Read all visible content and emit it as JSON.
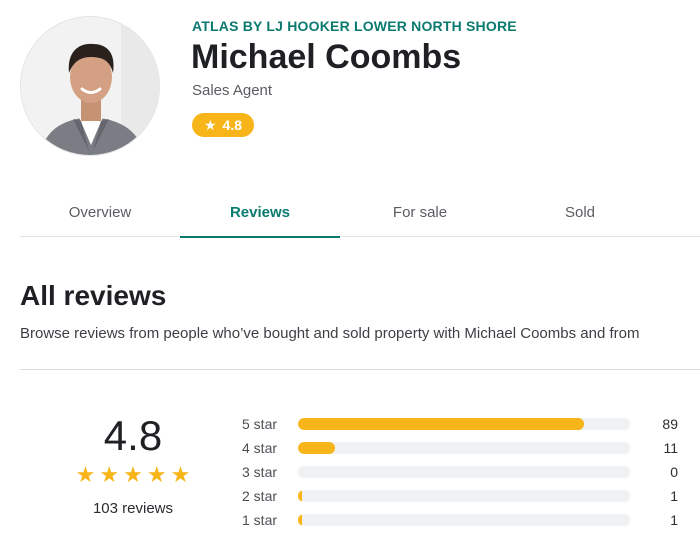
{
  "agent": {
    "agency": "ATLAS BY LJ HOOKER LOWER NORTH SHORE",
    "name": "Michael Coombs",
    "role": "Sales Agent",
    "rating": "4.8"
  },
  "tabs": [
    {
      "label": "Overview",
      "active": false
    },
    {
      "label": "Reviews",
      "active": true
    },
    {
      "label": "For sale",
      "active": false
    },
    {
      "label": "Sold",
      "active": false
    }
  ],
  "reviews": {
    "title": "All reviews",
    "description": "Browse reviews from people who’ve bought and sold property with Michael Coombs and from",
    "summary": {
      "score": "4.8",
      "stars": 5,
      "count_text": "103 reviews"
    },
    "breakdown": [
      {
        "label": "5 star",
        "count": "89",
        "fraction": 0.86
      },
      {
        "label": "4 star",
        "count": "11",
        "fraction": 0.11
      },
      {
        "label": "3 star",
        "count": "0",
        "fraction": 0
      },
      {
        "label": "2 star",
        "count": "1",
        "fraction": 0.011
      },
      {
        "label": "1 star",
        "count": "1",
        "fraction": 0.011
      }
    ]
  },
  "icons": {
    "star": "star-icon"
  },
  "colors": {
    "accent": "#0b7a6e",
    "rating": "#f7b51a",
    "track": "#f0f1f3"
  }
}
